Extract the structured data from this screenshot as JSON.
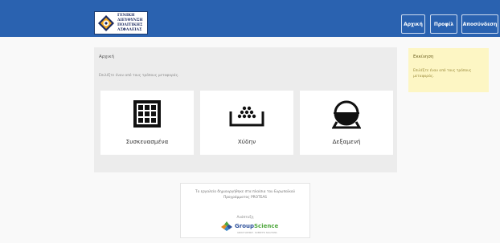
{
  "header": {
    "logo_lines": [
      "ΓΕΝΙΚΗ",
      "ΔΙΕΥΘΥΝΣΗ",
      "ΠΟΛΙΤΙΚΗΣ",
      "ΑΣΦΑΛΕΙΑΣ"
    ],
    "nav": [
      {
        "label": "Αρχική"
      },
      {
        "label": "Προφίλ"
      },
      {
        "label": "Αποσύνδεση"
      }
    ]
  },
  "main": {
    "title": "Αρχική",
    "subtitle": "Επιλέξτε έναν από τους τρόπους μεταφοράς.",
    "cards": [
      {
        "label": "Συσκευασμένα",
        "icon": "grid-box-icon"
      },
      {
        "label": "Χύδην",
        "icon": "bulk-pile-icon"
      },
      {
        "label": "Δεξαμενή",
        "icon": "tank-icon"
      }
    ]
  },
  "info": {
    "title": "Εκκίνηση",
    "text": "Επιλέξτε έναν από τους τρόπους μεταφοράς."
  },
  "footer": {
    "text": "Το εργαλείο δημιουργήθηκε στα πλαίσια του Ευρωπαϊκού Προγράμματος PROTEAS",
    "developed_by": "Ανάπτυξη",
    "brand_part1": "Group",
    "brand_part2": "Science",
    "brand_tagline": "GROUP SCIENCE · SCIENTIFIC SOLUTIONS"
  },
  "colors": {
    "header": "#2a62b0",
    "panel": "#ececec",
    "info": "#fdf6c4"
  }
}
